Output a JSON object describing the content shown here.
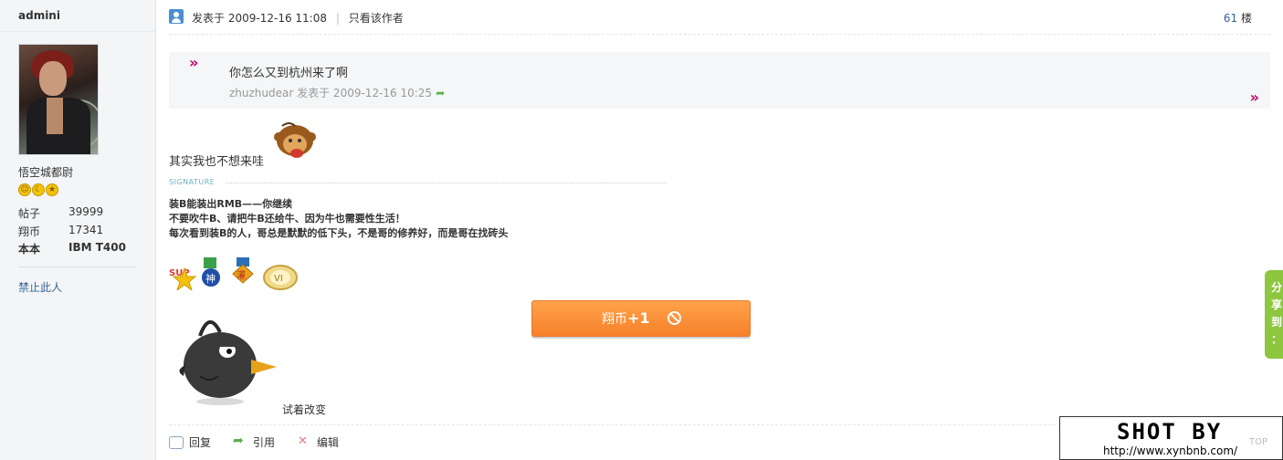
{
  "sidebar": {
    "username": "admini",
    "title": "悟空城都尉",
    "stats": [
      {
        "label": "帖子",
        "value": "39999"
      },
      {
        "label": "翔币",
        "value": "17341"
      },
      {
        "label": "本本",
        "value": "IBM T400"
      }
    ],
    "ban_link": "禁止此人"
  },
  "post": {
    "posted_label": "发表于",
    "posted_time": "2009-12-16 11:08",
    "only_author": "只看该作者",
    "floor_number": "61",
    "floor_unit": "楼",
    "quote": {
      "text": "你怎么又到杭州来了啊",
      "meta": "zhuzhudear 发表于  2009-12-16 10:25"
    },
    "message": "其实我也不想来哇",
    "signature_label": "SIGNATURE",
    "signature_lines": [
      "装B能装出RMB——你继续",
      "不要吹牛B、请把牛B还给牛、因为牛也需要性生活！",
      "每次看到装B的人，哥总是默默的低下头，不是哥的修养好，而是哥在找砖头"
    ],
    "coin_button": {
      "label": "翔币",
      "plus": "+1"
    },
    "image_caption": "试着改变",
    "actions": {
      "reply": "回复",
      "quote": "引用",
      "edit": "编辑"
    }
  },
  "share_tab": {
    "chars": [
      "分",
      "享",
      "到",
      "："
    ]
  },
  "watermark": {
    "title": "SHOT BY",
    "url": "http://www.xynbnb.com/",
    "top": "TOP"
  },
  "colors": {
    "link": "#336699",
    "quote_marker": "#c2006b",
    "coin_button": "#f6812a",
    "share_tab": "#8dc63f"
  }
}
